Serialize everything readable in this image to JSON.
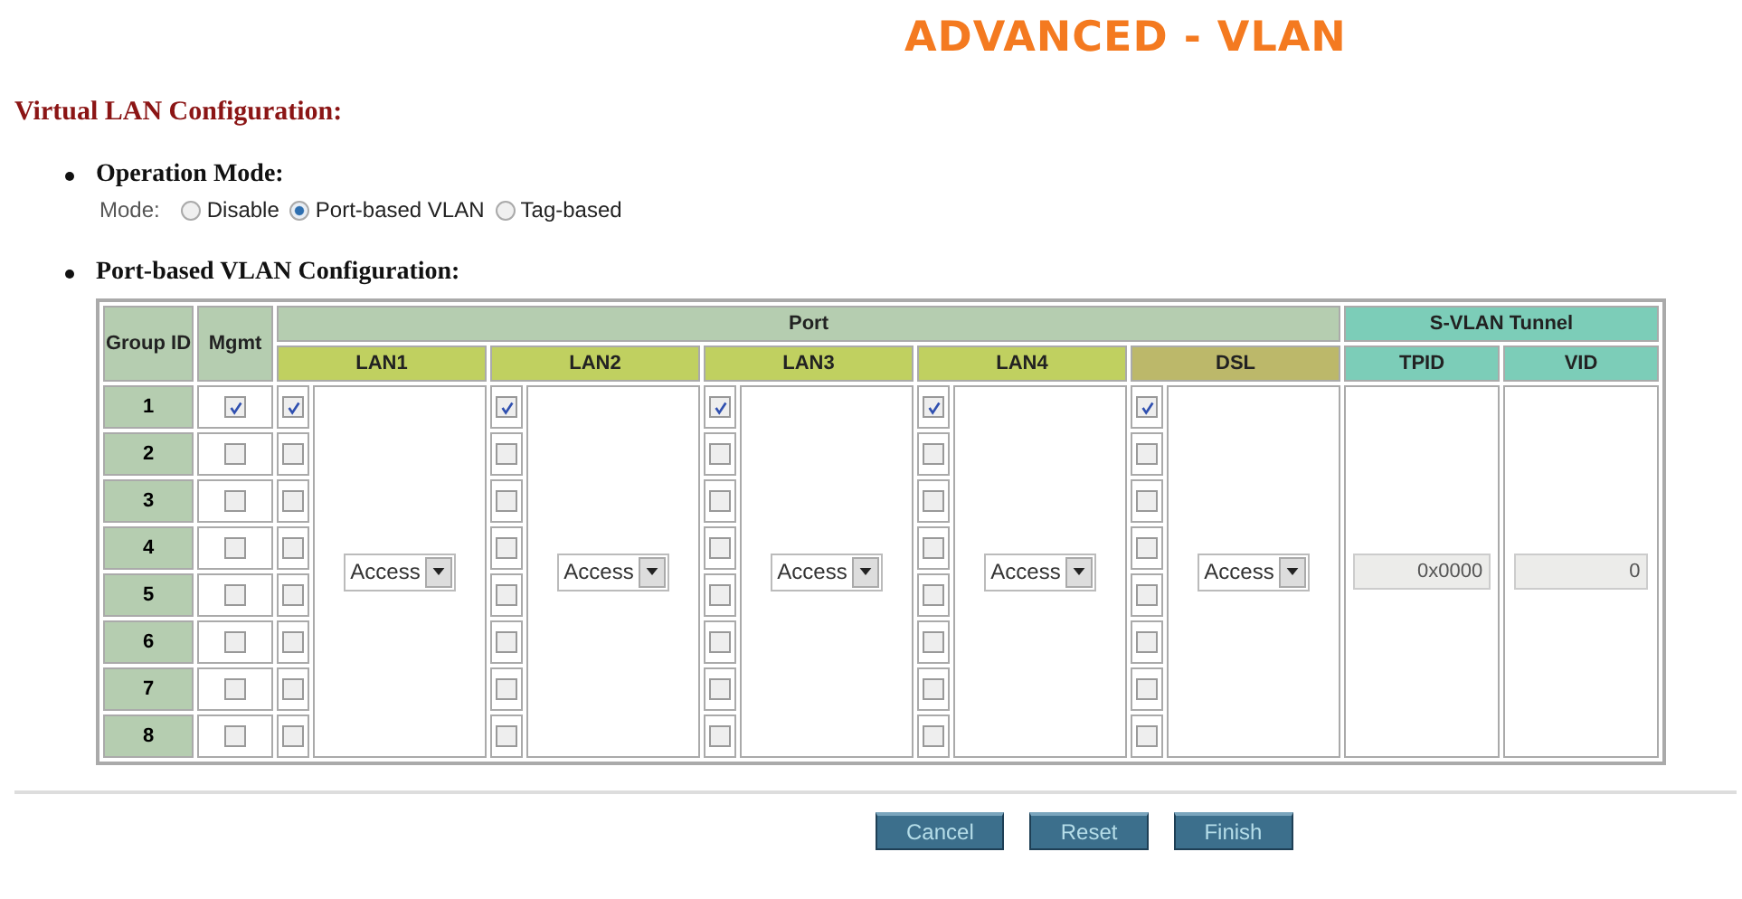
{
  "title": "ADVANCED - VLAN",
  "section_title": "Virtual LAN Configuration:",
  "operation_mode": {
    "heading": "Operation Mode:",
    "label": "Mode:",
    "options": [
      {
        "label": "Disable",
        "selected": false
      },
      {
        "label": "Port-based VLAN",
        "selected": true
      },
      {
        "label": "Tag-based",
        "selected": false
      }
    ]
  },
  "port_config": {
    "heading": "Port-based VLAN Configuration:",
    "group_header": "Group ID",
    "mgmt_header": "Mgmt",
    "port_header": "Port",
    "tunnel_header": "S-VLAN Tunnel",
    "ports": [
      {
        "name": "LAN1",
        "kind": "lan",
        "mode": "Access"
      },
      {
        "name": "LAN2",
        "kind": "lan",
        "mode": "Access"
      },
      {
        "name": "LAN3",
        "kind": "lan",
        "mode": "Access"
      },
      {
        "name": "LAN4",
        "kind": "lan",
        "mode": "Access"
      },
      {
        "name": "DSL",
        "kind": "dsl",
        "mode": "Access"
      }
    ],
    "tunnel_columns": [
      {
        "name": "TPID",
        "value": "0x0000"
      },
      {
        "name": "VID",
        "value": "0"
      }
    ],
    "rows": [
      {
        "group_id": "1",
        "mgmt": true,
        "ports": [
          true,
          true,
          true,
          true,
          true
        ]
      },
      {
        "group_id": "2",
        "mgmt": false,
        "ports": [
          false,
          false,
          false,
          false,
          false
        ]
      },
      {
        "group_id": "3",
        "mgmt": false,
        "ports": [
          false,
          false,
          false,
          false,
          false
        ]
      },
      {
        "group_id": "4",
        "mgmt": false,
        "ports": [
          false,
          false,
          false,
          false,
          false
        ]
      },
      {
        "group_id": "5",
        "mgmt": false,
        "ports": [
          false,
          false,
          false,
          false,
          false
        ]
      },
      {
        "group_id": "6",
        "mgmt": false,
        "ports": [
          false,
          false,
          false,
          false,
          false
        ]
      },
      {
        "group_id": "7",
        "mgmt": false,
        "ports": [
          false,
          false,
          false,
          false,
          false
        ]
      },
      {
        "group_id": "8",
        "mgmt": false,
        "ports": [
          false,
          false,
          false,
          false,
          false
        ]
      }
    ]
  },
  "buttons": [
    "Cancel",
    "Reset",
    "Finish"
  ]
}
